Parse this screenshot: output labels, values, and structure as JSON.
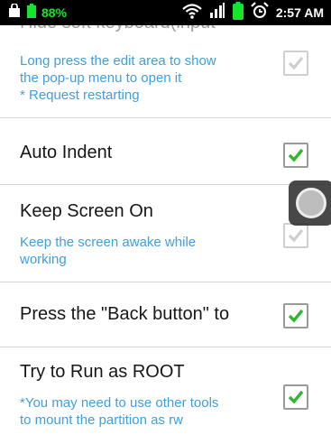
{
  "status_bar": {
    "battery_percent": "88%",
    "time": "2:57 AM",
    "icons": [
      "shopping-bag-icon",
      "wifi-icon",
      "signal-icon",
      "battery-icon",
      "alarm-icon"
    ]
  },
  "settings": [
    {
      "title": "Hide soft keyboard(input",
      "summary": "Long press the edit area to show\nthe pop-up menu to open it\n* Request restarting",
      "checked": true,
      "enabled": false
    },
    {
      "title": "Auto Indent",
      "summary": "",
      "checked": true,
      "enabled": true
    },
    {
      "title": "Keep Screen On",
      "summary": "Keep the screen awake while\nworking",
      "checked": true,
      "enabled": false
    },
    {
      "title": "Press the \"Back button\" to",
      "summary": "",
      "checked": true,
      "enabled": true
    },
    {
      "title": "Try to Run as ROOT",
      "summary": "*You may need to use other tools\nto mount the partition as rw",
      "checked": true,
      "enabled": true
    }
  ],
  "colors": {
    "status_bar": "#000000",
    "summary_text": "#3fa0de",
    "check_enabled": "#2fb82f",
    "check_disabled": "#cfcfcf",
    "battery_text": "#17e42c"
  }
}
